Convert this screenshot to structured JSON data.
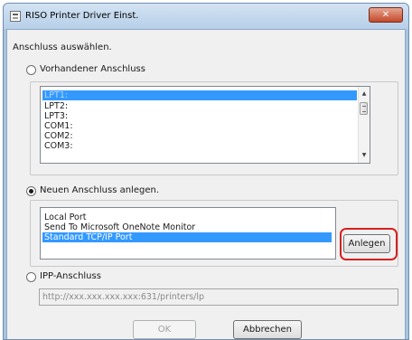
{
  "window": {
    "title": "RISO Printer Driver Einst.",
    "close_glyph": "✕"
  },
  "dialog": {
    "heading": "Anschluss auswählen.",
    "existing_port": {
      "label": "Vorhandener Anschluss",
      "selected": false,
      "items": [
        "LPT1:",
        "LPT2:",
        "LPT3:",
        "COM1:",
        "COM2:",
        "COM3:"
      ],
      "selected_item": "LPT1:"
    },
    "new_port": {
      "label": "Neuen Anschluss anlegen.",
      "selected": true,
      "items": [
        "Local Port",
        "Send To Microsoft OneNote Monitor",
        "Standard TCP/IP Port"
      ],
      "selected_item": "Standard TCP/IP Port",
      "create_button": "Anlegen"
    },
    "ipp": {
      "label": "IPP-Anschluss",
      "selected": false,
      "url": "http://xxx.xxx.xxx.xxx:631/printers/lp"
    },
    "buttons": {
      "ok": "OK",
      "cancel": "Abbrechen"
    }
  },
  "colors": {
    "selection": "#3399ff",
    "highlight_ring": "#d62020",
    "title_bar": "#b7cfe8"
  },
  "icons": {
    "window_icon": "printer-icon",
    "scroll_up": "arrow-up-icon",
    "scroll_down": "arrow-down-icon"
  }
}
